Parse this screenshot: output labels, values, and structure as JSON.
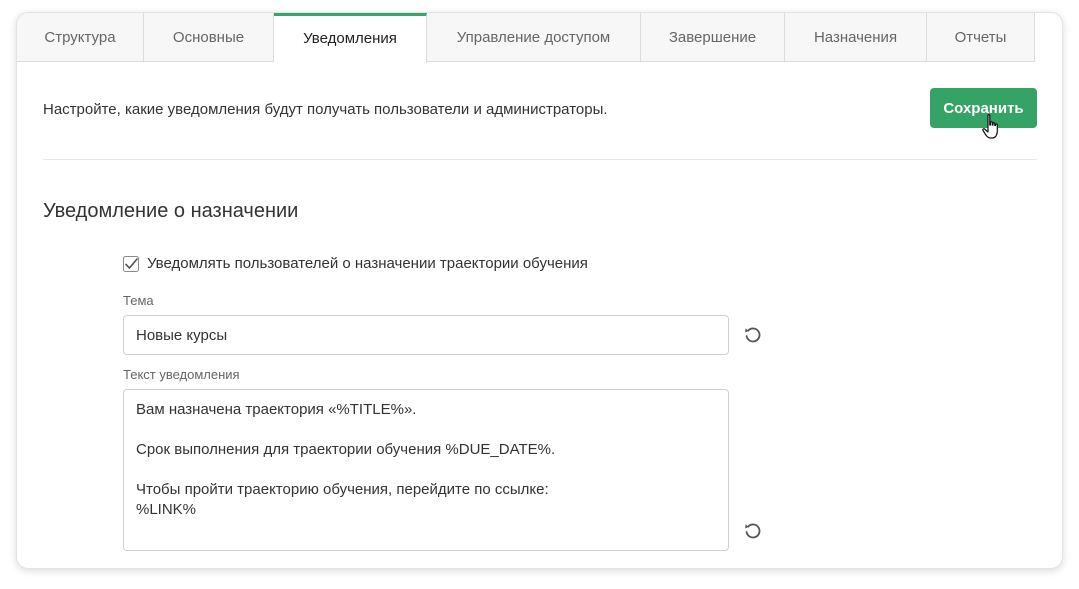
{
  "tabs": [
    {
      "label": "Структура",
      "active": false
    },
    {
      "label": "Основные",
      "active": false
    },
    {
      "label": "Уведомления",
      "active": true
    },
    {
      "label": "Управление доступом",
      "active": false
    },
    {
      "label": "Завершение",
      "active": false
    },
    {
      "label": "Назначения",
      "active": false
    },
    {
      "label": "Отчеты",
      "active": false
    }
  ],
  "intro_text": "Настройте, какие уведомления будут получать пользователи и администраторы.",
  "save_label": "Сохранить",
  "section": {
    "title": "Уведомление о назначении",
    "checkbox_label": "Уведомлять пользователей о назначении траектории обучения",
    "checkbox_checked": true,
    "subject_label": "Тема",
    "subject_value": "Новые курсы",
    "body_label": "Текст уведомления",
    "body_value": "Вам назначена траектория «%TITLE%».\n\nСрок выполнения для траектории обучения %DUE_DATE%.\n\nЧтобы пройти траекторию обучения, перейдите по ссылке:\n%LINK%"
  },
  "icons": {
    "reset": "reset-icon",
    "cursor": "hand-pointer-icon",
    "check": "checkmark-icon"
  },
  "colors": {
    "accent": "#34a365",
    "active_tab_border": "#3aa46e"
  }
}
